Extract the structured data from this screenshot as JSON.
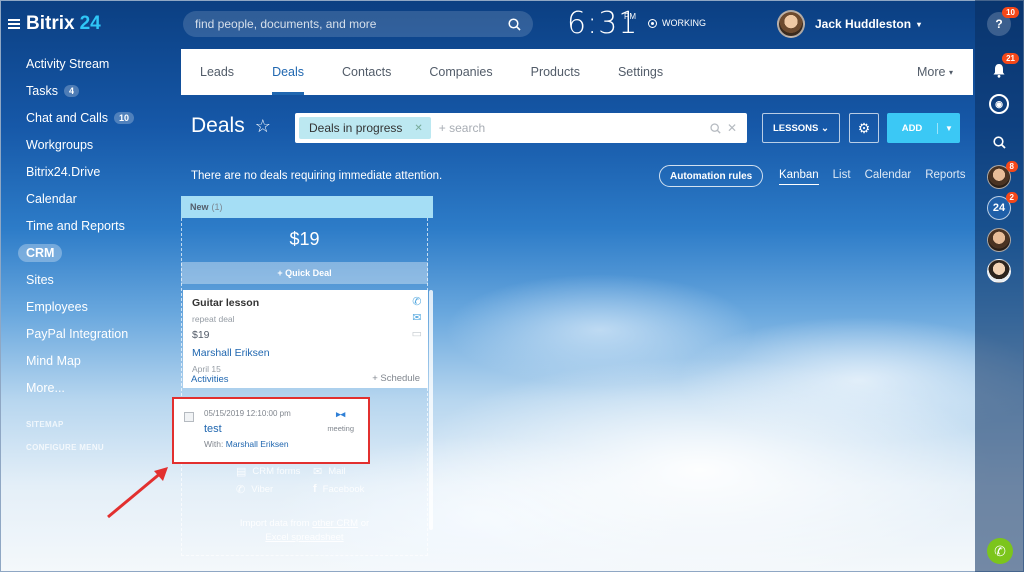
{
  "logo": {
    "name": "Bitrix",
    "number": "24"
  },
  "sidebar": {
    "items": [
      {
        "label": "Activity Stream"
      },
      {
        "label": "Tasks",
        "counter": "4"
      },
      {
        "label": "Chat and Calls",
        "counter": "10"
      },
      {
        "label": "Workgroups"
      },
      {
        "label": "Bitrix24.Drive"
      },
      {
        "label": "Calendar"
      },
      {
        "label": "Time and Reports"
      },
      {
        "label": "CRM",
        "active": true
      },
      {
        "label": "Sites"
      },
      {
        "label": "Employees"
      },
      {
        "label": "PayPal Integration"
      },
      {
        "label": "Mind Map"
      },
      {
        "label": "More..."
      }
    ],
    "sitemap": "SITEMAP",
    "configure": "CONFIGURE MENU"
  },
  "header": {
    "search_placeholder": "find people, documents, and more",
    "time": "6:31",
    "ampm": "PM",
    "status": "WORKING",
    "user_name": "Jack Huddleston"
  },
  "right_panel": {
    "help_badge": "10",
    "notify_badge": "21",
    "avatar1_badge": "8",
    "b24_label": "24",
    "b24_badge": "2"
  },
  "tabs": [
    "Leads",
    "Deals",
    "Contacts",
    "Companies",
    "Products",
    "Settings"
  ],
  "tabs_more": "More",
  "page": {
    "title": "Deals",
    "filter_chip": "Deals in progress",
    "filter_placeholder": "+ search",
    "lessons": "LESSONS",
    "add": "ADD",
    "notice": "There are no deals requiring immediate attention.",
    "automation": "Automation rules",
    "views": [
      "Kanban",
      "List",
      "Calendar",
      "Reports"
    ]
  },
  "column": {
    "name": "New",
    "count": "(1)",
    "total": "$19",
    "quick_deal": "+ Quick Deal"
  },
  "deal": {
    "title": "Guitar lesson",
    "subtitle": "repeat deal",
    "price": "$19",
    "contact": "Marshall Eriksen",
    "date": "April 15",
    "activities": "Activities",
    "schedule": "+ Schedule"
  },
  "activity": {
    "datetime": "05/15/2019 12:10:00 pm",
    "title": "test",
    "with_label": "With:",
    "with_name": "Marshall Eriksen",
    "type": "meeting"
  },
  "ghost": {
    "crm_forms": "CRM forms",
    "mail": "Mail",
    "viber": "Viber",
    "facebook": "Facebook",
    "import_prefix": "Import data from",
    "import_link1": "other CRM",
    "import_or": "or",
    "import_link2": "Excel spreadsheet"
  },
  "colors": {
    "accent": "#2067b0",
    "add_button": "#3bc8f5",
    "highlight_box": "#e2302f",
    "column_header": "#a5def5"
  }
}
